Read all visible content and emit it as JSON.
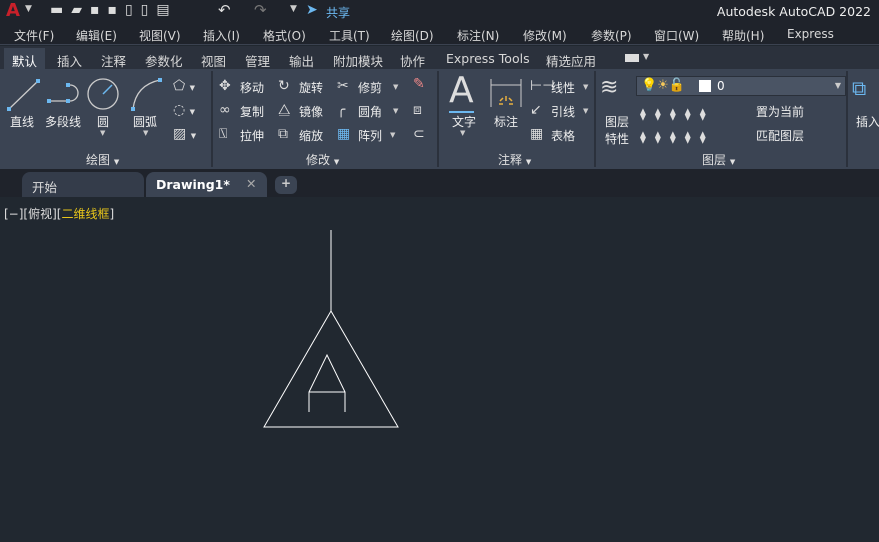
{
  "title": "Autodesk AutoCAD 2022",
  "quick_access": {
    "share_label": "共享",
    "icons": [
      "autocad-logo",
      "new",
      "open",
      "save",
      "save-as",
      "open-from-mobile",
      "save-to-mobile",
      "plot",
      "undo",
      "redo",
      "customize"
    ]
  },
  "menu": [
    "文件(F)",
    "编辑(E)",
    "视图(V)",
    "插入(I)",
    "格式(O)",
    "工具(T)",
    "绘图(D)",
    "标注(N)",
    "修改(M)",
    "参数(P)",
    "窗口(W)",
    "帮助(H)",
    "Express"
  ],
  "ribbon_tabs": [
    "默认",
    "插入",
    "注释",
    "参数化",
    "视图",
    "管理",
    "输出",
    "附加模块",
    "协作",
    "Express Tools",
    "精选应用"
  ],
  "panels": {
    "draw": {
      "label": "绘图",
      "line": "直线",
      "polyline": "多段线",
      "circle": "圆",
      "arc": "圆弧"
    },
    "modify": {
      "label": "修改",
      "move": "移动",
      "rotate": "旋转",
      "trim": "修剪",
      "copy": "复制",
      "mirror": "镜像",
      "fillet": "圆角",
      "stretch": "拉伸",
      "scale": "缩放",
      "array": "阵列"
    },
    "annotation": {
      "label": "注释",
      "text": "文字",
      "dimension": "标注",
      "linear": "线性",
      "leader": "引线",
      "table": "表格"
    },
    "layers": {
      "label": "图层",
      "properties_1": "图层",
      "properties_2": "特性",
      "current_layer": "0",
      "make_current": "置为当前",
      "match_layer": "匹配图层"
    },
    "insert": {
      "label": "插入"
    }
  },
  "doc_tabs": [
    {
      "label": "开始"
    },
    {
      "label": "Drawing1*",
      "active": true
    }
  ],
  "viewport": {
    "minus": "[−]",
    "view": "[俯视]",
    "style_open": "[",
    "style": "二维线框",
    "style_close": "]"
  },
  "colors": {
    "accent": "#6cb8f0",
    "visual_style": "#e8c61a",
    "logo": "#c8202a"
  }
}
